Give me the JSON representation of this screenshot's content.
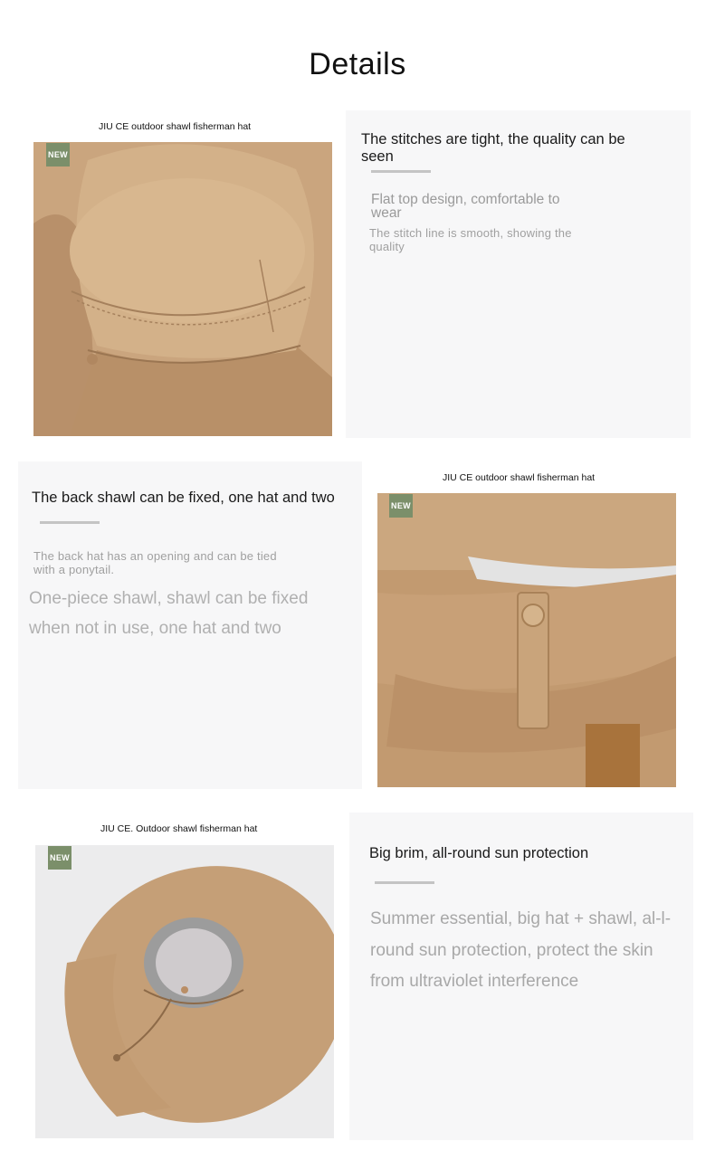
{
  "page": {
    "title": "Details"
  },
  "sections": [
    {
      "caption": "JIU CE outdoor shawl fisherman hat",
      "badge": "NEW",
      "heading": "The stitches are tight, the quality can be seen",
      "subheading": "Flat top design, comfortable to wear",
      "body": "The stitch line is smooth, showing the quality"
    },
    {
      "caption": "JIU CE outdoor shawl fisherman hat",
      "badge": "NEW",
      "heading": "The back shawl can be fixed, one hat and two",
      "subheading": "The back hat has an opening and can be tied with a ponytail.",
      "body": "One-piece shawl, shawl can be fixed when not in use, one hat and two"
    },
    {
      "caption": "JIU CE. Outdoor shawl fisherman hat",
      "badge": "NEW",
      "heading": "Big brim, all-round sun protection",
      "body": "Summer essential, big hat + shawl, al-l-round sun protection, protect the skin from ultraviolet interference"
    }
  ],
  "colors": {
    "hat_khaki": "#c9a47d",
    "badge_green": "#7b8f6a",
    "panel_bg": "#f7f7f8"
  }
}
